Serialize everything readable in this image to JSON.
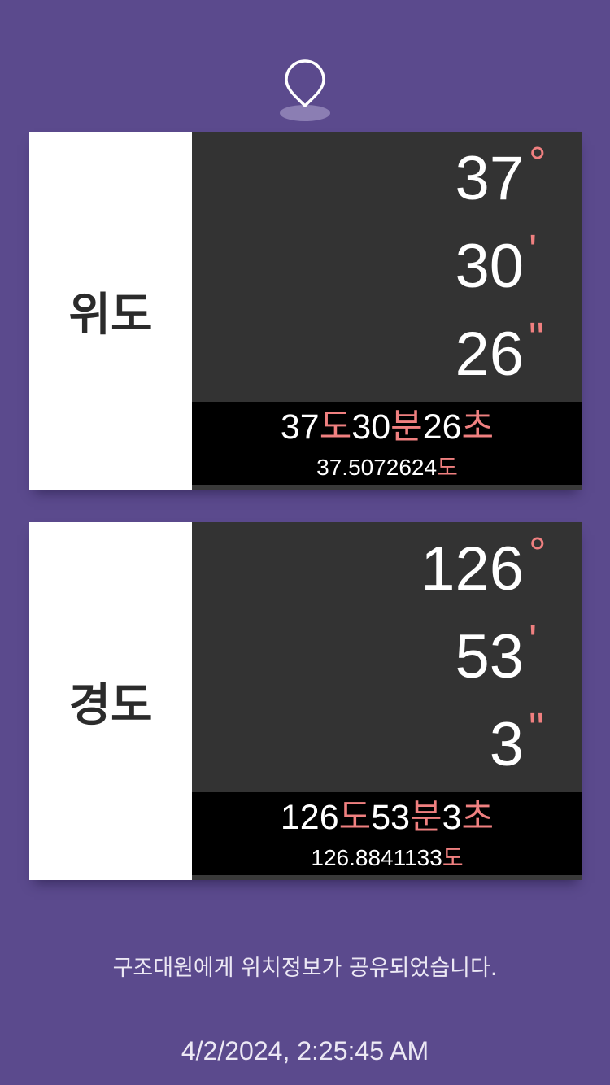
{
  "icon": "map-pin-icon",
  "colors": {
    "background": "#5b4a8d",
    "panel": "#333333",
    "summary": "#000000",
    "accent": "#f08080",
    "label_bg": "#ffffff"
  },
  "latitude": {
    "label": "위도",
    "deg": "37",
    "deg_unit": "°",
    "min": "30",
    "min_unit": "'",
    "sec": "26",
    "sec_unit": "\"",
    "summary": {
      "deg": "37",
      "deg_word": "도",
      "min": "30",
      "min_word": "분",
      "sec": "26",
      "sec_word": "초"
    },
    "decimal": "37.5072624",
    "decimal_unit": "도"
  },
  "longitude": {
    "label": "경도",
    "deg": "126",
    "deg_unit": "°",
    "min": "53",
    "min_unit": "'",
    "sec": "3",
    "sec_unit": "\"",
    "summary": {
      "deg": "126",
      "deg_word": "도",
      "min": "53",
      "min_word": "분",
      "sec": "3",
      "sec_word": "초"
    },
    "decimal": "126.8841133",
    "decimal_unit": "도"
  },
  "notice": "구조대원에게 위치정보가 공유되었습니다.",
  "timestamp": "4/2/2024, 2:25:45 AM"
}
